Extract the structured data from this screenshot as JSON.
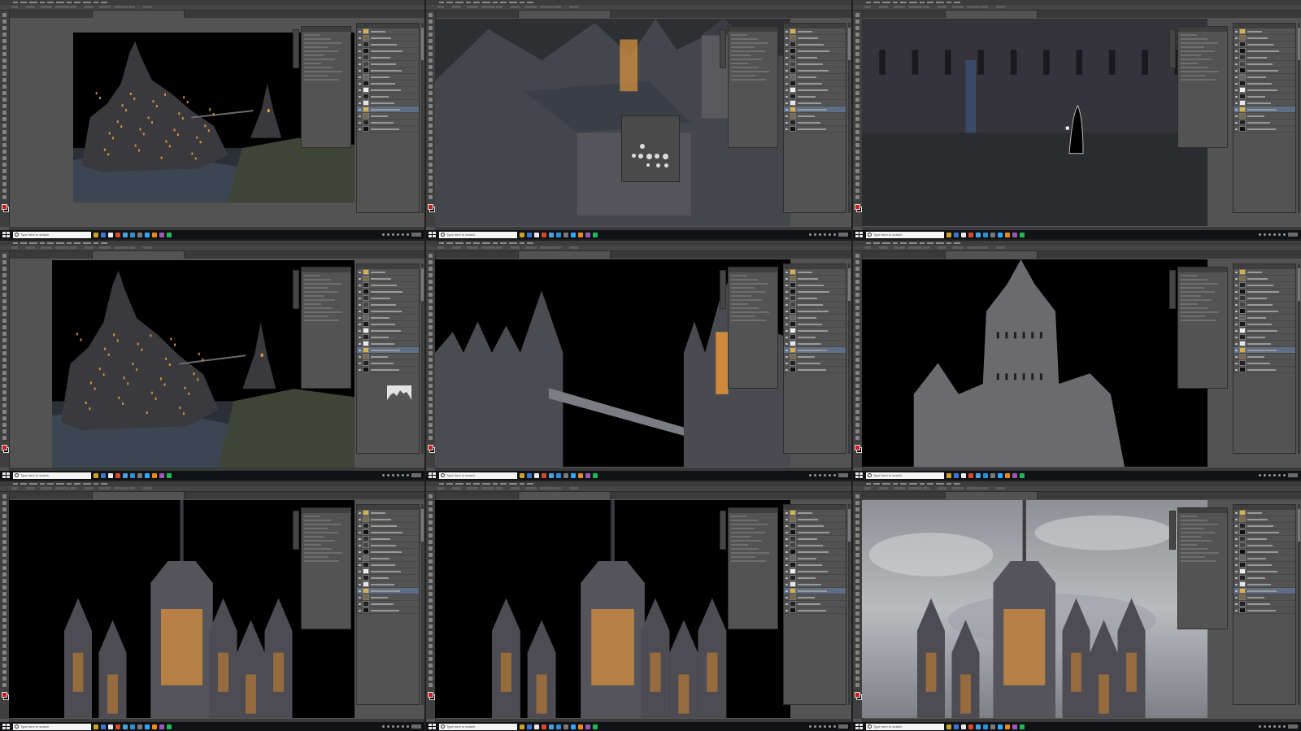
{
  "screens": [
    {
      "name": "screen-1",
      "variant": "scene-full-1"
    },
    {
      "name": "screen-2",
      "variant": "castle-closeup-brush"
    },
    {
      "name": "screen-3",
      "variant": "wall-closeup"
    },
    {
      "name": "screen-4",
      "variant": "scene-full-2"
    },
    {
      "name": "screen-5",
      "variant": "towers-bridge"
    },
    {
      "name": "screen-6",
      "variant": "tower-night"
    },
    {
      "name": "screen-7",
      "variant": "lit-tower-1"
    },
    {
      "name": "screen-8",
      "variant": "lit-tower-2"
    },
    {
      "name": "screen-9",
      "variant": "tower-sky"
    }
  ],
  "taskbar": {
    "search_placeholder": "Type here to search",
    "app_icons": [
      "#c9a227",
      "#3a78d4",
      "#e8e8e8",
      "#d84a2b",
      "#4aa3df",
      "#2d8fd5",
      "#7a7a7a",
      "#31a8ff",
      "#e88b1a",
      "#9b59b6",
      "#1db954"
    ]
  },
  "colors": {
    "app_bg": "#535353",
    "panel_bg": "#535353",
    "menubar": "#3c3c3c",
    "selected_layer": "#5e6e86",
    "foreground_swatch": "#d01d1d",
    "background_swatch": "#000000",
    "taskbar": "#101216"
  }
}
